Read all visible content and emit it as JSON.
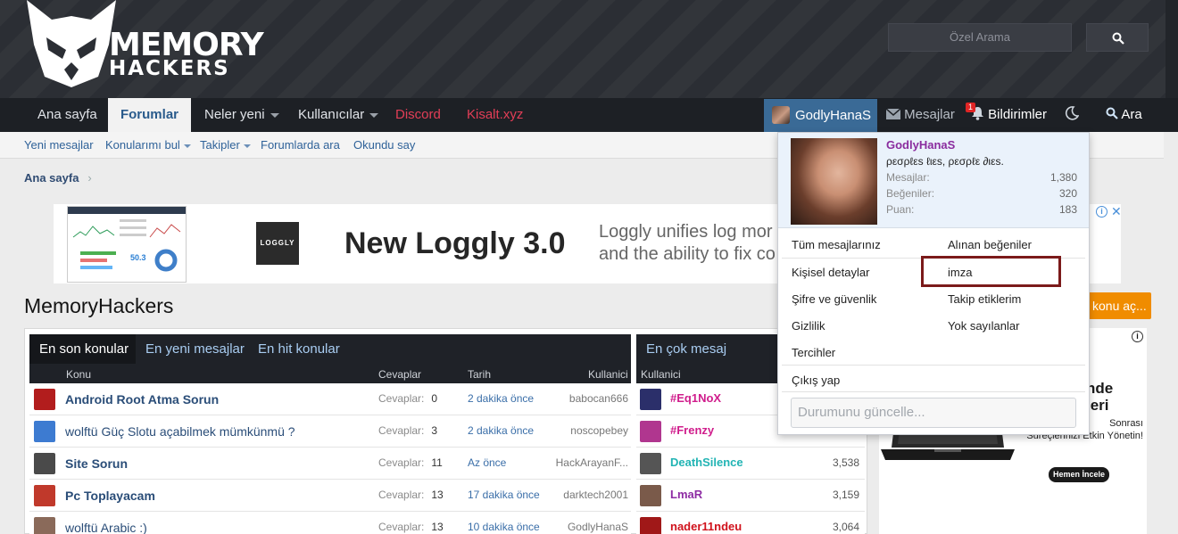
{
  "header": {
    "logo_line1": "MEMORY",
    "logo_line2": "HACKERS",
    "search_placeholder": "Özel Arama"
  },
  "nav": {
    "items": [
      "Ana sayfa",
      "Forumlar",
      "Neler yeni",
      "Kullanıcılar",
      "Discord",
      "Kisalt.xyz"
    ],
    "user": "GodlyHanaS",
    "messages": "Mesajlar",
    "alerts": "Bildirimler",
    "alerts_badge": "1",
    "search": "Ara"
  },
  "subnav": [
    "Yeni mesajlar",
    "Konularımı bul",
    "Takipler",
    "Forumlarda ara",
    "Okundu say"
  ],
  "breadcrumb": "Ana sayfa",
  "ad": {
    "brand": "LOGGLY",
    "headline": "New Loggly 3.0",
    "desc": "Loggly unifies log mor\nand the ability to fix co",
    "thumb_value": "50.3"
  },
  "page_title": "MemoryHackers",
  "new_topic_btn": "konu aç...",
  "tabs": [
    "En son konular",
    "En yeni mesajlar",
    "En hit konular"
  ],
  "columns": {
    "topic": "Konu",
    "replies": "Cevaplar",
    "date": "Tarih",
    "user": "Kullanici"
  },
  "topics": [
    {
      "title": "Android Root Atma Sorun",
      "bold": true,
      "replies_label": "Cevaplar:",
      "replies": "0",
      "date": "2 dakika önce",
      "user": "babocan666",
      "avatar": "#b21d1d"
    },
    {
      "title": "wolftü Güç Slotu açabilmek mümkünmü ?",
      "bold": false,
      "replies_label": "Cevaplar:",
      "replies": "3",
      "date": "2 dakika önce",
      "user": "noscopebey",
      "avatar": "#3d7bd1"
    },
    {
      "title": "Site Sorun",
      "bold": true,
      "replies_label": "Cevaplar:",
      "replies": "11",
      "date": "Az önce",
      "user": "HackArayanF...",
      "avatar": "#4a4a4a"
    },
    {
      "title": "Pc Toplayacam",
      "bold": true,
      "replies_label": "Cevaplar:",
      "replies": "13",
      "date": "17 dakika önce",
      "user": "darktech2001",
      "avatar": "#c0392b"
    },
    {
      "title": "wolftü Arabic :)",
      "bold": false,
      "replies_label": "Cevaplar:",
      "replies": "13",
      "date": "10 dakika önce",
      "user": "GodlyHanaS",
      "avatar": "#8a6a5a"
    }
  ],
  "top_posters": {
    "tab": "En çok mesaj",
    "column": "Kullanici",
    "items": [
      {
        "name": "#Eq1NoX",
        "count": "",
        "color": "#d01d8c",
        "avatar": "#2b2f6a"
      },
      {
        "name": "#Frenzy",
        "count": "",
        "color": "#d01d8c",
        "avatar": "#b0368f"
      },
      {
        "name": "DeathSilence",
        "count": "3,538",
        "color": "#22b4b4",
        "avatar": "#555555"
      },
      {
        "name": "LmaR",
        "count": "3,159",
        "color": "#8e2da4",
        "avatar": "#7a5a4a"
      },
      {
        "name": "nader11ndeu",
        "count": "3,064",
        "color": "#d0121c",
        "avatar": "#a01818"
      }
    ]
  },
  "side_ad": {
    "headline1": "nde",
    "headline2": "leri",
    "text": "Sonrası\nSüreçlerinizi Etkin Yönetin!",
    "button": "Hemen İncele"
  },
  "dropdown": {
    "username": "GodlyHanaS",
    "user_title": "ρεσρℓεѕ ℓιεѕ, ρεσρℓε ∂ιεѕ.",
    "stats": [
      {
        "label": "Mesajlar:",
        "value": "1,380"
      },
      {
        "label": "Beğeniler:",
        "value": "320"
      },
      {
        "label": "Puan:",
        "value": "183"
      }
    ],
    "links_left": [
      "Tüm mesajlarınız",
      "Kişisel detaylar",
      "Şifre ve güvenlik",
      "Gizlilik",
      "Tercihler"
    ],
    "links_right": [
      "Alınan beğeniler",
      "imza",
      "Takip etiklerim",
      "Yok sayılanlar"
    ],
    "logout": "Çıkış yap",
    "status_placeholder": "Durumunu güncelle..."
  }
}
